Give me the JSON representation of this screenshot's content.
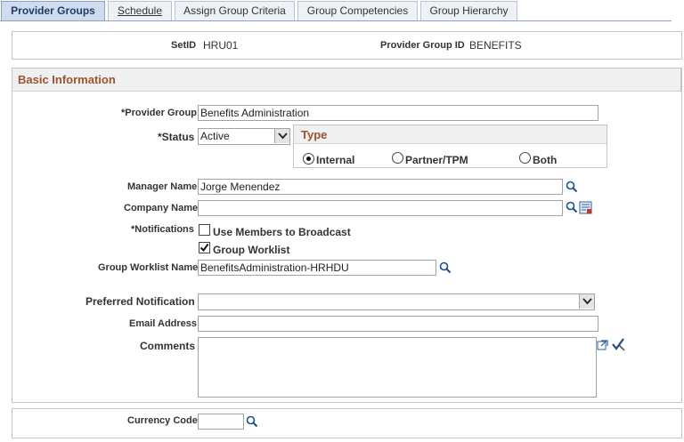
{
  "tabs": [
    {
      "label": "Provider Groups"
    },
    {
      "label": "Schedule"
    },
    {
      "label": "Assign Group Criteria"
    },
    {
      "label": "Group Competencies"
    },
    {
      "label": "Group Hierarchy"
    }
  ],
  "header": {
    "setid_label": "SetID",
    "setid_value": "HRU01",
    "provider_group_id_label": "Provider Group ID",
    "provider_group_id_value": "BENEFITS"
  },
  "basic_info": {
    "title": "Basic Information",
    "provider_group_label": "*Provider Group",
    "provider_group_value": "Benefits Administration",
    "status_label": "*Status",
    "status_value": "Active",
    "type": {
      "title": "Type",
      "options": [
        "Internal",
        "Partner/TPM",
        "Both"
      ],
      "selected": "Internal"
    },
    "manager_name_label": "Manager Name",
    "manager_name_value": "Jorge Menendez",
    "company_name_label": "Company Name",
    "company_name_value": "",
    "notifications_label": "*Notifications",
    "notif_broadcast_label": "Use Members to Broadcast",
    "notif_broadcast_checked": false,
    "notif_worklist_label": "Group Worklist",
    "notif_worklist_checked": true,
    "group_worklist_name_label": "Group Worklist Name",
    "group_worklist_name_value": "BenefitsAdministration-HRHDU",
    "preferred_notification_label": "Preferred Notification",
    "preferred_notification_value": "",
    "email_address_label": "Email Address",
    "email_address_value": "",
    "comments_label": "Comments",
    "comments_value": ""
  },
  "currency": {
    "label": "Currency Code",
    "value": ""
  },
  "colors": {
    "section_title": "#a0522d",
    "tab_active_bg": "#cfdced",
    "tab_bg": "#eef2f7"
  }
}
